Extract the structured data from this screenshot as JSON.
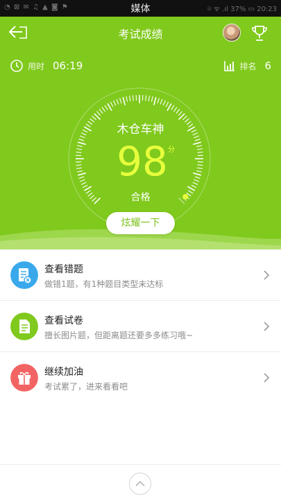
{
  "status_bar": {
    "title": "媒体",
    "left_icons": "◔ ⊠ ✉ ♫ ▲ ◙ ⚑",
    "right_info": "⌾ ᯤ .ıl 37% ▭ 20:23"
  },
  "header": {
    "title": "考试成绩",
    "back_icon": "back-arrow-icon",
    "trophy_icon": "trophy-icon"
  },
  "stats": {
    "time_label": "用时",
    "time_value": "06:19",
    "rank_label": "排名",
    "rank_value": "6"
  },
  "result": {
    "username": "木仓车神",
    "score": "98",
    "score_unit": "分",
    "score_fraction": 0.98,
    "status": "合格",
    "share_button": "炫耀一下"
  },
  "menu": [
    {
      "title": "查看错题",
      "subtitle": "做错1题，有1种题目类型未达标",
      "icon": "wrong-questions-icon",
      "color": "#3aa9ec"
    },
    {
      "title": "查看试卷",
      "subtitle": "擅长图片题，但距离题还要多多练习哦~",
      "icon": "exam-paper-icon",
      "color": "#80c91d"
    },
    {
      "title": "继续加油",
      "subtitle": "考试累了，进来看看吧",
      "icon": "gift-icon",
      "color": "#f26463"
    }
  ],
  "colors": {
    "hero_green": "#80c91d",
    "score_yellow": "#e6ff3d"
  }
}
